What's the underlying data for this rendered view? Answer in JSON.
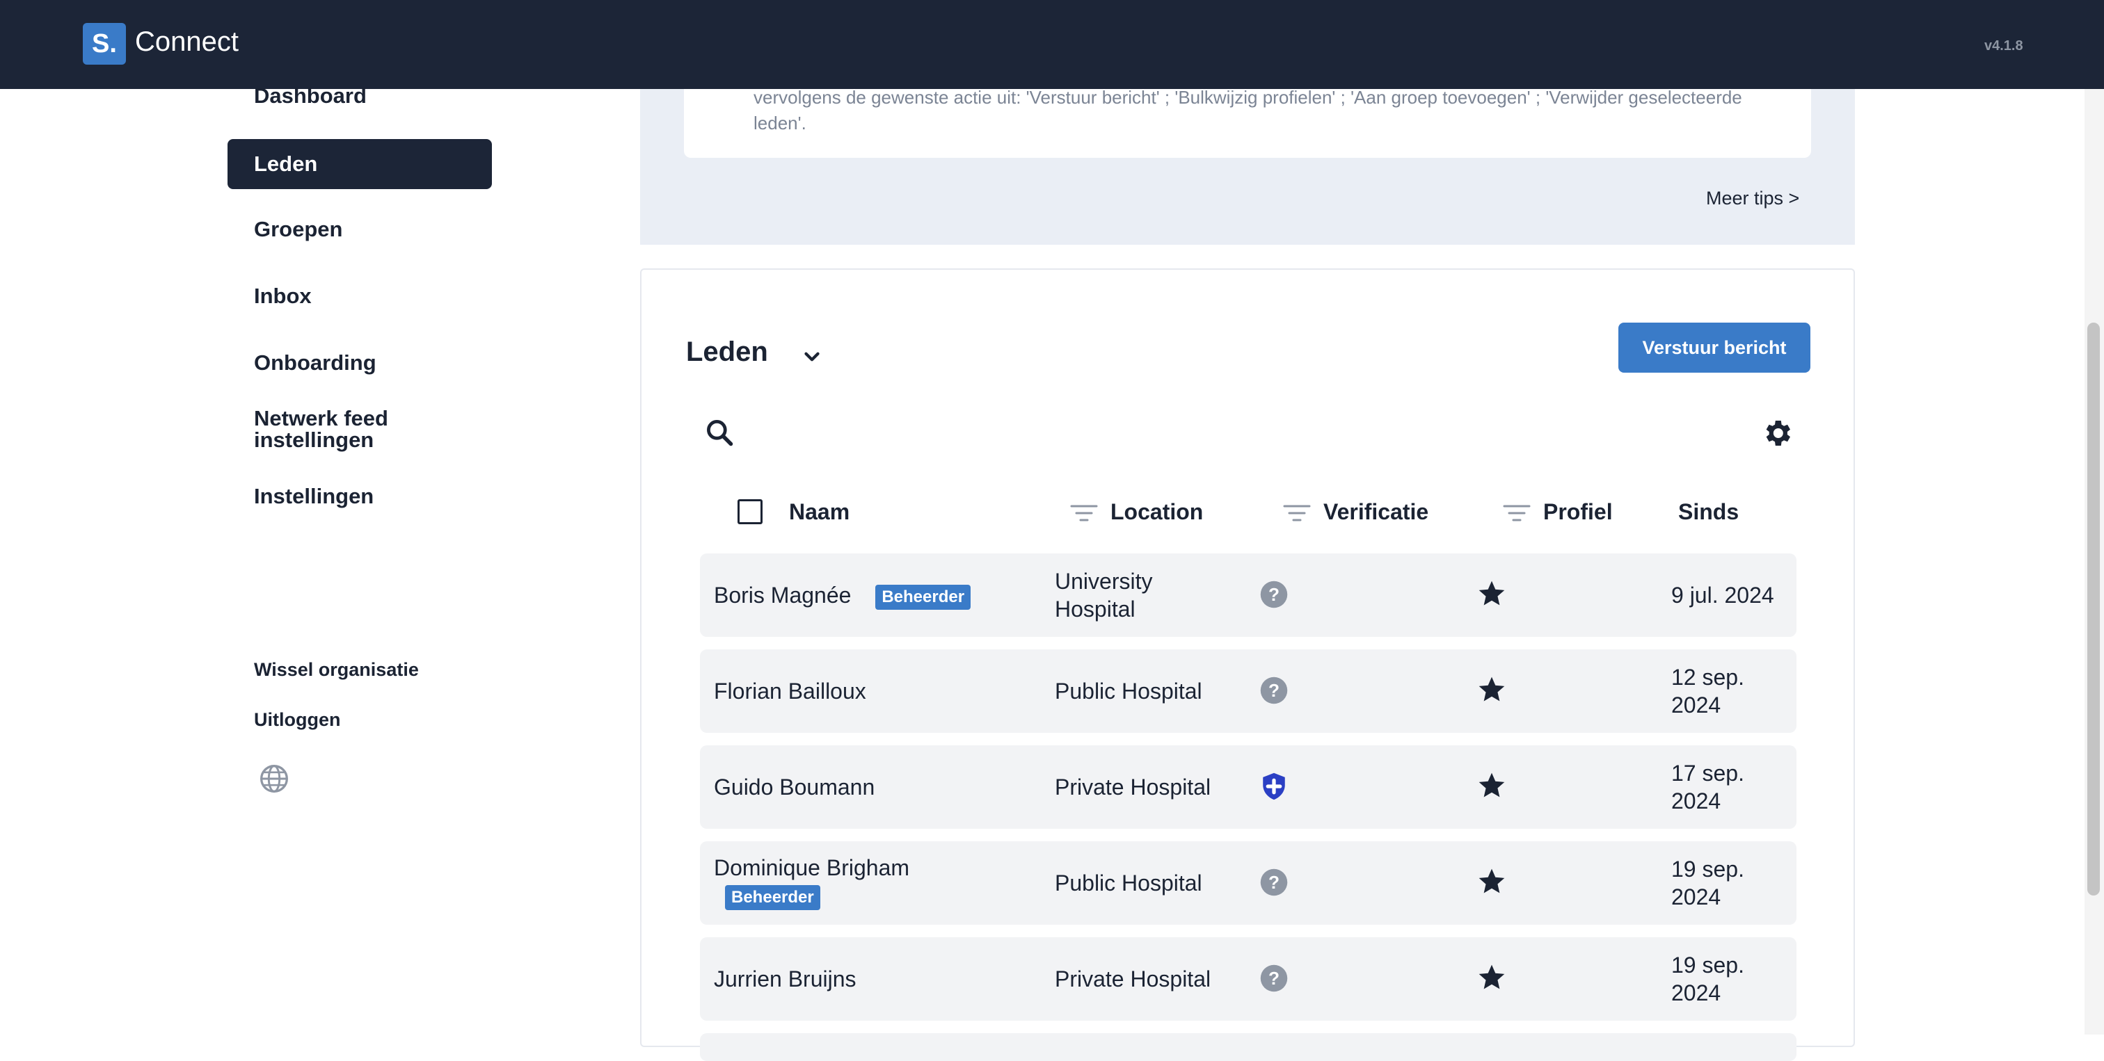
{
  "header": {
    "logo_letter": "S.",
    "app_name": "Connect",
    "version": "v4.1.8"
  },
  "sidebar": {
    "items": [
      {
        "label": "Dashboard"
      },
      {
        "label": "Leden",
        "active": true
      },
      {
        "label": "Groepen"
      },
      {
        "label": "Inbox"
      },
      {
        "label": "Onboarding"
      },
      {
        "label": "Netwerk feed instellingen"
      },
      {
        "label": "Instellingen"
      }
    ],
    "switch_org": "Wissel organisatie",
    "logout": "Uitloggen",
    "language_icon": "globe-icon"
  },
  "tips": {
    "text": "vervolgens de gewenste actie uit: 'Verstuur bericht' ; 'Bulkwijzig profielen' ; 'Aan groep toevoegen' ; 'Verwijder geselecteerde leden'.",
    "more_link": "Meer tips >"
  },
  "members": {
    "title": "Leden",
    "send_button": "Verstuur bericht",
    "columns": {
      "name": "Naam",
      "location": "Location",
      "verification": "Verificatie",
      "profile": "Profiel",
      "since": "Sinds"
    },
    "rows": [
      {
        "name": "Boris Magnée",
        "badge": "Beheerder",
        "location": "University Hospital",
        "verification": "unknown",
        "since": "9 jul. 2024"
      },
      {
        "name": "Florian Bailloux",
        "badge": "",
        "location": "Public Hospital",
        "verification": "unknown",
        "since": "12 sep. 2024"
      },
      {
        "name": "Guido Boumann",
        "badge": "",
        "location": "Private Hospital",
        "verification": "verified",
        "since": "17 sep. 2024"
      },
      {
        "name": "Dominique Brigham",
        "badge": "Beheerder",
        "location": "Public Hospital",
        "verification": "unknown",
        "since": "19 sep. 2024"
      },
      {
        "name": "Jurrien Bruijns",
        "badge": "",
        "location": "Private Hospital",
        "verification": "unknown",
        "since": "19 sep. 2024"
      }
    ]
  },
  "colors": {
    "navy": "#1c2537",
    "accent": "#3a7bc8",
    "verified": "#2b3fc4"
  }
}
